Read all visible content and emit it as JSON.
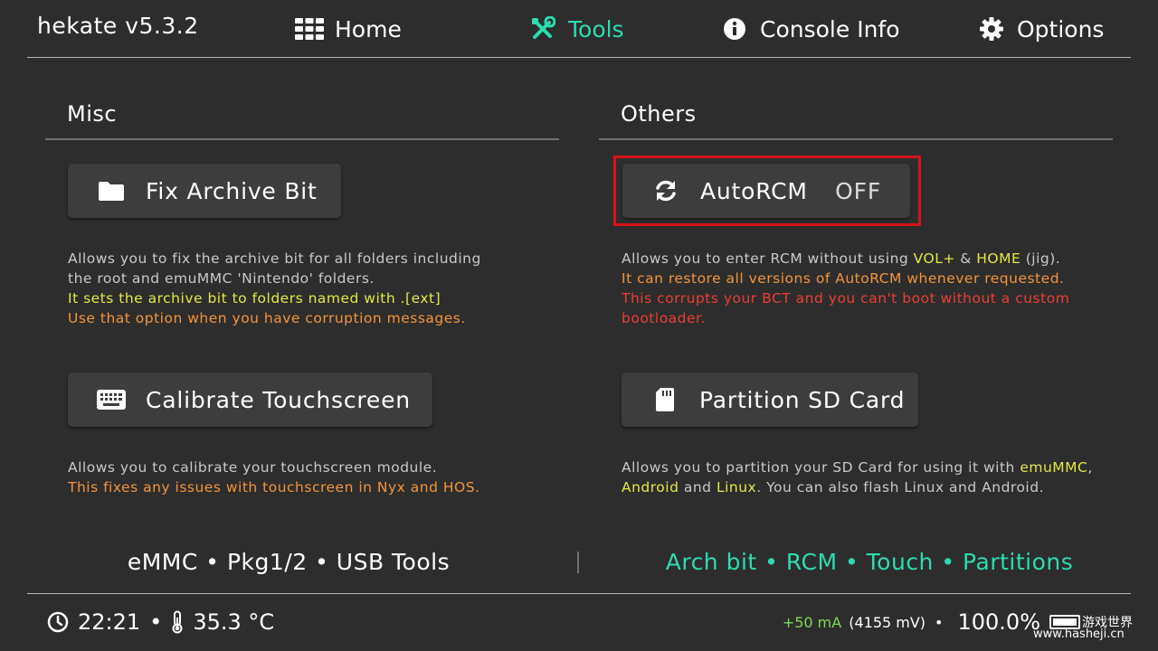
{
  "header": {
    "app_title": "hekate v5.3.2",
    "tabs": [
      {
        "label": "Home",
        "icon": "grid-icon",
        "active": false
      },
      {
        "label": "Tools",
        "icon": "tools-icon",
        "active": true
      },
      {
        "label": "Console Info",
        "icon": "info-icon",
        "active": false
      },
      {
        "label": "Options",
        "icon": "gear-icon",
        "active": false
      }
    ]
  },
  "misc": {
    "title": "Misc",
    "fix_archive": {
      "label": "Fix Archive Bit",
      "icon": "folder-icon",
      "desc": [
        {
          "text": "Allows you to fix the archive bit for all folders including",
          "color": "#c9c9c9"
        },
        {
          "text": "the root and emuMMC 'Nintendo' folders.",
          "color": "#c9c9c9"
        },
        {
          "text": "It sets the archive bit to folders named with .[ext]",
          "color": "#e3e843"
        },
        {
          "text": "Use that option when you have corruption messages.",
          "color": "#f4943a"
        }
      ]
    },
    "calibrate": {
      "label": "Calibrate Touchscreen",
      "icon": "keyboard-icon",
      "desc": [
        {
          "text": "Allows you to calibrate your touchscreen module.",
          "color": "#c9c9c9"
        },
        {
          "text": "This fixes any issues with touchscreen in Nyx and HOS.",
          "color": "#f4943a"
        }
      ]
    }
  },
  "others": {
    "title": "Others",
    "autorcm": {
      "label": "AutoRCM",
      "state": "OFF",
      "icon": "refresh-icon",
      "desc_line1": {
        "a": "Allows you to enter RCM without using ",
        "b": "VOL+",
        "c": " & ",
        "d": "HOME",
        "e": " (jig)."
      },
      "desc_line2": "It can restore all versions of AutoRCM whenever requested.",
      "desc_line3": "This corrupts your BCT and you can't boot without a custom",
      "desc_line4": "bootloader."
    },
    "partition": {
      "label": "Partition SD Card",
      "icon": "sd-card-icon",
      "desc_line1": {
        "a": "Allows you to partition your SD Card for using it with ",
        "b": "emuMMC",
        "c": ","
      },
      "desc_line2": {
        "a": "Android",
        "b": " and ",
        "c": "Linux",
        "d": ". You can also flash Linux and Android."
      }
    }
  },
  "bottom": {
    "left_tools": "eMMC • Pkg1/2 • USB Tools",
    "right_tools": "Arch bit • RCM • Touch • Partitions"
  },
  "status": {
    "time": "22:21",
    "temp": "35.3 °C",
    "current": "+50 mA",
    "voltage": "(4155 mV)",
    "battery_pct": "100.0%"
  },
  "watermark": {
    "cn": "游戏世界",
    "url": "www.hasheji.cn"
  },
  "colors": {
    "accent": "#2ddbb1",
    "yellow": "#e3e843",
    "orange": "#f4943a",
    "red": "#ec3e34",
    "highlight": "#d6131b"
  }
}
